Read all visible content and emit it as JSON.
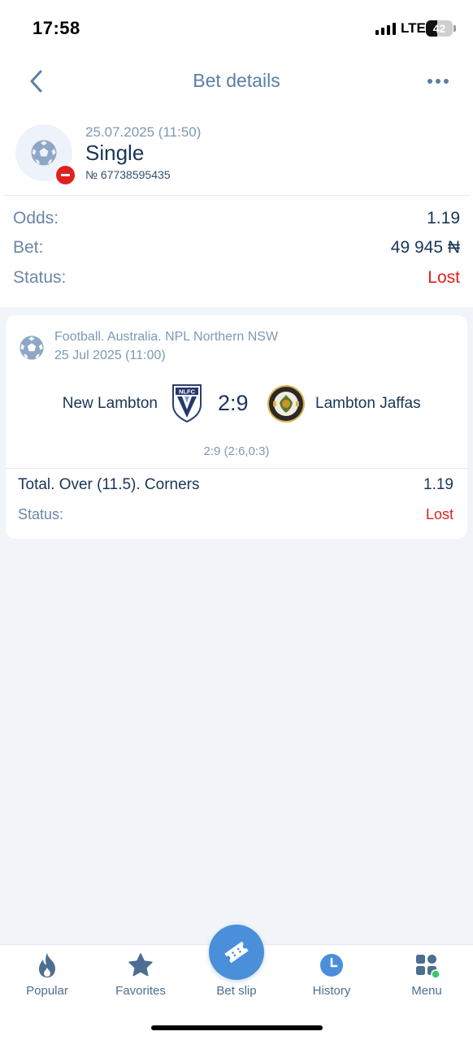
{
  "status_bar": {
    "time": "17:58",
    "network": "LTE",
    "battery": "42",
    "battery_level": 0.42
  },
  "nav": {
    "title": "Bet details",
    "back_icon": "chevron-left-icon",
    "more_icon": "more-horizontal-icon"
  },
  "bet": {
    "date": "25.07.2025 (11:50)",
    "type": "Single",
    "number": "№ 67738595435",
    "icon": "soccer-ball-icon",
    "badge_icon": "minus-circle-icon"
  },
  "summary": [
    {
      "label": "Odds:",
      "value": "1.19",
      "lost": false
    },
    {
      "label": "Bet:",
      "value": "49 945 ₦",
      "lost": false
    },
    {
      "label": "Status:",
      "value": "Lost",
      "lost": true
    }
  ],
  "event": {
    "league": "Football. Australia. NPL Northern NSW",
    "date": "25 Jul 2025 (11:00)",
    "team1": "New Lambton",
    "team2": "Lambton Jaffas",
    "team1_logo_text": "NLFC",
    "score": "2:9",
    "sub_score": "2:9 (2:6,0:3)",
    "market": "Total. Over (11.5). Corners",
    "odds": "1.19",
    "status_label": "Status:",
    "status_value": "Lost"
  },
  "tabs": [
    {
      "label": "Popular",
      "icon": "flame-icon"
    },
    {
      "label": "Favorites",
      "icon": "star-icon"
    },
    {
      "label": "Bet slip",
      "icon": "ticket-icon"
    },
    {
      "label": "History",
      "icon": "clock-icon"
    },
    {
      "label": "Menu",
      "icon": "grid-menu-icon"
    }
  ],
  "colors": {
    "accent": "#4a8fd9",
    "lost": "#e02020",
    "text": "#1a3557",
    "muted": "#7d98b5"
  }
}
